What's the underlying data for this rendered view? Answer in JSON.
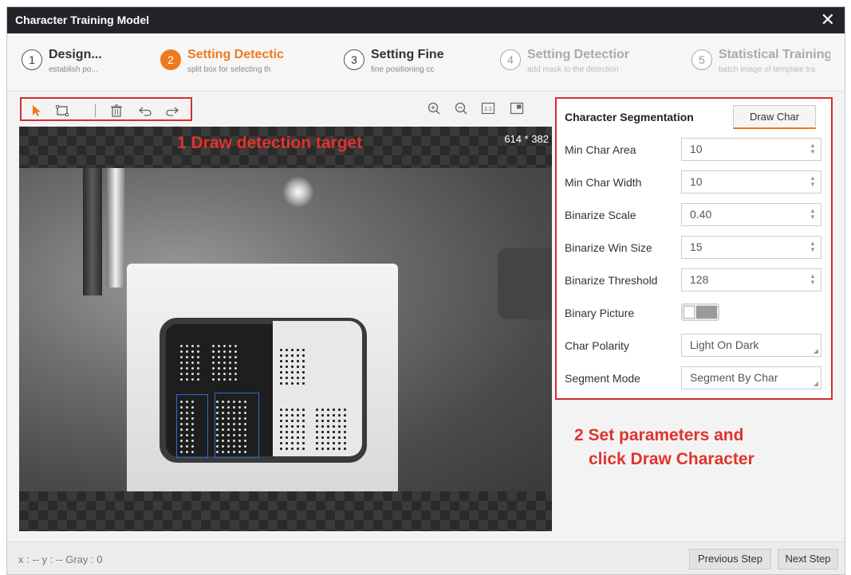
{
  "window": {
    "title": "Character Training Model",
    "close_icon": "close-icon"
  },
  "steps": [
    {
      "num": "1",
      "title": "Design...",
      "desc": "establish po...",
      "state": "done"
    },
    {
      "num": "2",
      "title": "Setting Detectic",
      "desc": "split box for selecting th",
      "state": "active"
    },
    {
      "num": "3",
      "title": "Setting Fine",
      "desc": "fine positioning cc",
      "state": "done"
    },
    {
      "num": "4",
      "title": "Setting Detectior",
      "desc": "add mask to the detection",
      "state": "inactive"
    },
    {
      "num": "5",
      "title": "Statistical Training",
      "desc": "batch image of template tra",
      "state": "inactive"
    }
  ],
  "toolbar": {
    "tools": [
      "select-arrow-icon",
      "rectangle-icon",
      "delete-icon",
      "undo-icon",
      "redo-icon"
    ],
    "zoom_tools": [
      "zoom-in-icon",
      "zoom-out-icon",
      "actual-size-icon",
      "fit-window-icon"
    ],
    "actual_size_label": "1:1"
  },
  "canvas": {
    "size_label": "614 * 382"
  },
  "annotations": {
    "step1": "1 Draw detection target",
    "step2_line1": "2 Set parameters and",
    "step2_line2": "click Draw Character"
  },
  "panel": {
    "title": "Character Segmentation",
    "draw_button": "Draw Char",
    "params": [
      {
        "label": "Min Char Area",
        "value": "10"
      },
      {
        "label": "Min Char Width",
        "value": "10"
      },
      {
        "label": "Binarize Scale",
        "value": "0.40"
      },
      {
        "label": "Binarize Win Size",
        "value": "15"
      },
      {
        "label": "Binarize Threshold",
        "value": "128"
      }
    ],
    "binary_picture": {
      "label": "Binary Picture",
      "on": false
    },
    "char_polarity": {
      "label": "Char Polarity",
      "value": "Light On Dark"
    },
    "segment_mode": {
      "label": "Segment Mode",
      "value": "Segment By Char"
    }
  },
  "status": {
    "coords": "x : --   y : --    Gray : 0",
    "prev_button": "Previous Step",
    "next_button": "Next Step"
  },
  "colors": {
    "accent": "#ee7a1f",
    "annotation": "#e0332d",
    "titlebar": "#22242a",
    "char_box": "#2f6bd6"
  }
}
